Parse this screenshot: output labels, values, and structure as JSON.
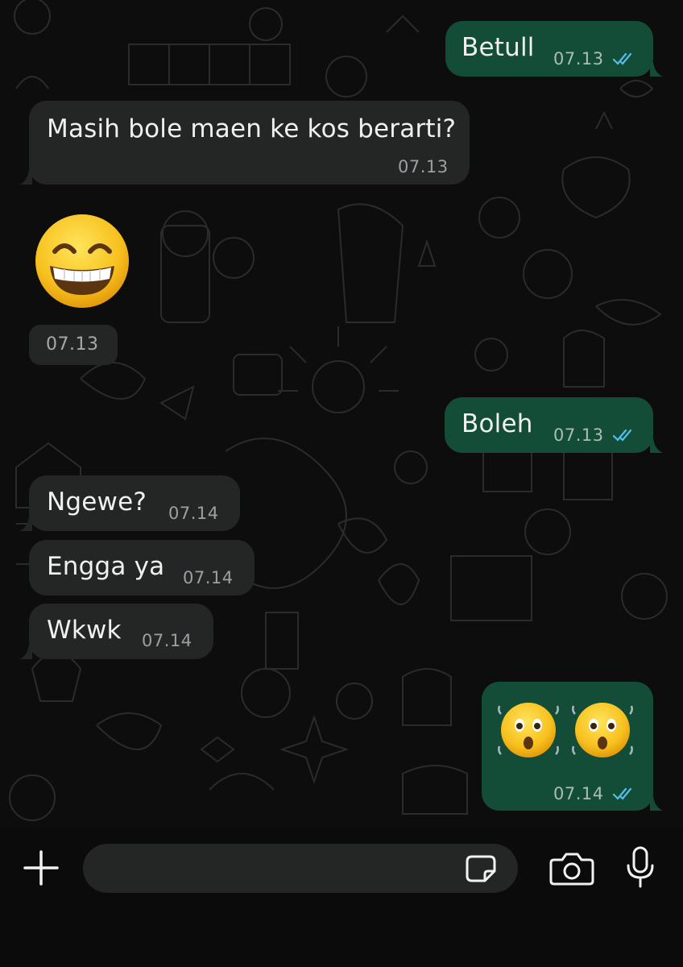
{
  "messages": [
    {
      "id": "m1",
      "direction": "outgoing",
      "text": "Betull",
      "time": "07.13",
      "status": "read"
    },
    {
      "id": "m2",
      "direction": "incoming",
      "text": "Masih bole maen ke kos berarti?",
      "time": "07.13"
    },
    {
      "id": "m3",
      "direction": "incoming",
      "emoji": "grinning-face-with-smiling-eyes",
      "time": "07.13"
    },
    {
      "id": "m4",
      "direction": "outgoing",
      "text": "Boleh",
      "time": "07.13",
      "status": "read"
    },
    {
      "id": "m5",
      "direction": "incoming",
      "text": "Ngewe?",
      "time": "07.14"
    },
    {
      "id": "m6",
      "direction": "incoming",
      "text": "Engga ya",
      "time": "07.14"
    },
    {
      "id": "m7",
      "direction": "incoming",
      "text": "Wkwk",
      "time": "07.14"
    },
    {
      "id": "m8",
      "direction": "outgoing",
      "emoji": "astonished-face-x2",
      "time": "07.14",
      "status": "read"
    }
  ],
  "composer": {
    "value": "",
    "icons": [
      "plus-icon",
      "sticker-icon",
      "camera-icon",
      "microphone-icon"
    ]
  },
  "colors": {
    "outgoing_bubble": "#144d37",
    "incoming_bubble": "#242626",
    "read_ticks": "#53bdeb",
    "background": "#0d0d0d"
  }
}
